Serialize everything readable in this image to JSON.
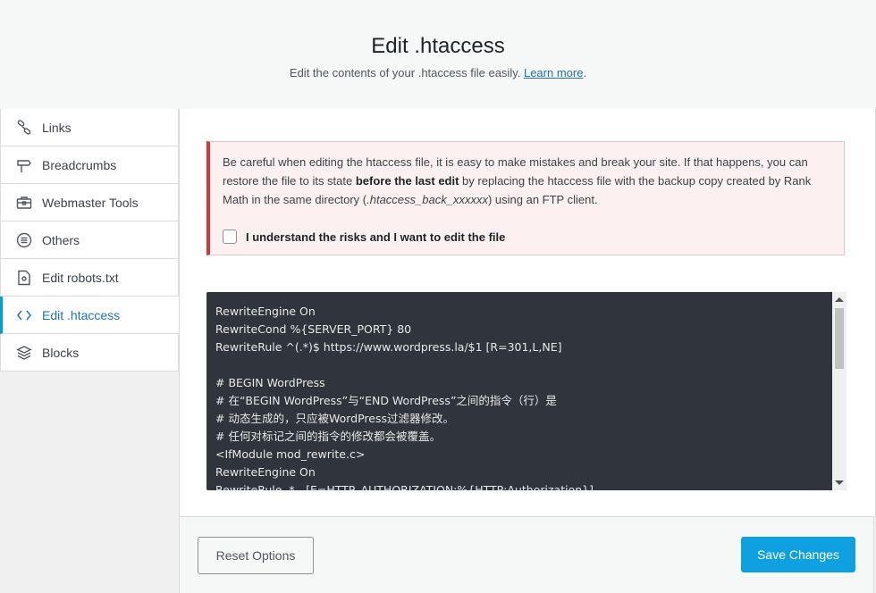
{
  "header": {
    "title": "Edit .htaccess",
    "subtitle_prefix": "Edit the contents of your .htaccess file easily. ",
    "learn_more": "Learn more",
    "subtitle_suffix": "."
  },
  "sidebar": {
    "items": [
      {
        "label": "Links",
        "icon": "link-icon"
      },
      {
        "label": "Breadcrumbs",
        "icon": "signpost-icon"
      },
      {
        "label": "Webmaster Tools",
        "icon": "toolbox-icon"
      },
      {
        "label": "Others",
        "icon": "list-circle-icon"
      },
      {
        "label": "Edit robots.txt",
        "icon": "file-icon"
      },
      {
        "label": "Edit .htaccess",
        "icon": "code-icon",
        "active": true
      },
      {
        "label": "Blocks",
        "icon": "blocks-icon"
      }
    ]
  },
  "notice": {
    "text_1": "Be careful when editing the htaccess file, it is easy to make mistakes and break your site. If that happens, you can restore the file to its state ",
    "text_bold": "before the last edit",
    "text_2": " by replacing the htaccess file with the backup copy created by Rank Math in the same directory (",
    "text_italic": ".htaccess_back_xxxxxx",
    "text_3": ") using an FTP client.",
    "checkbox_label": "I understand the risks and I want to edit the file",
    "checked": false
  },
  "editor": {
    "lines": [
      "RewriteEngine On",
      "RewriteCond %{SERVER_PORT} 80",
      "RewriteRule ^(.*)$ https://www.wordpress.la/$1 [R=301,L,NE]",
      "",
      "# BEGIN WordPress",
      "# 在“BEGIN WordPress”与“END WordPress”之间的指令（行）是",
      "# 动态生成的，只应被WordPress过滤器修改。",
      "# 任何对标记之间的指令的修改都会被覆盖。",
      "<IfModule mod_rewrite.c>",
      "RewriteEngine On",
      "RewriteRule .* - [E=HTTP_AUTHORIZATION:%{HTTP:Authorization}]"
    ]
  },
  "footer": {
    "reset_label": "Reset Options",
    "save_label": "Save Changes"
  },
  "colors": {
    "accent": "#00a0d2",
    "save_button": "#0ea0e0",
    "notice_border": "#d63638",
    "editor_bg": "#30343c"
  }
}
